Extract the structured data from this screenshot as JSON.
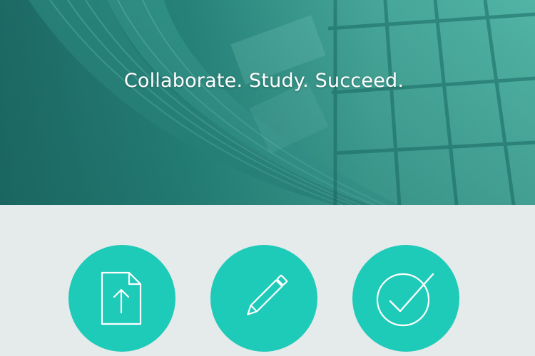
{
  "hero": {
    "tagline": "Collaborate. Study. Succeed."
  },
  "features": [
    {
      "icon": "upload-document-icon"
    },
    {
      "icon": "pencil-icon"
    },
    {
      "icon": "checkmark-circle-icon"
    }
  ],
  "colors": {
    "accent": "#1ecab8",
    "hero_dark": "#1f6b66",
    "hero_light": "#5cc4b2",
    "section_bg": "#e5eaea",
    "icon_stroke": "#ffffff"
  }
}
